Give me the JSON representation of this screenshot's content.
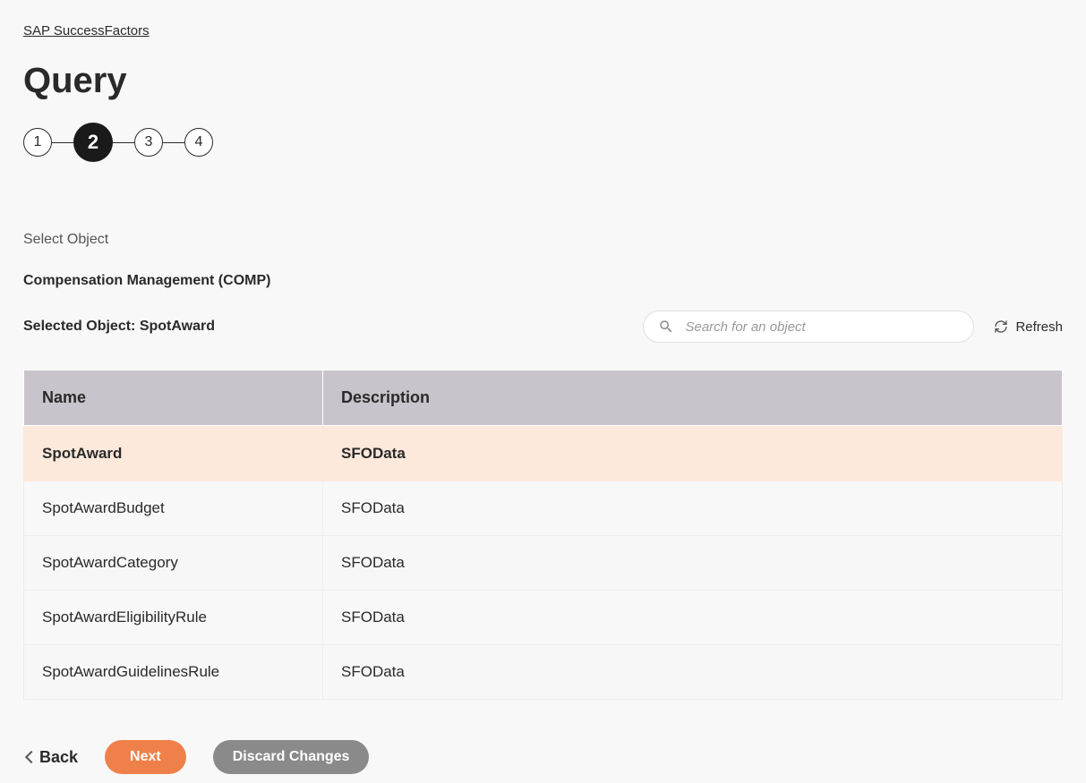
{
  "breadcrumb": "SAP SuccessFactors",
  "page_title": "Query",
  "stepper": {
    "steps": [
      "1",
      "2",
      "3",
      "4"
    ],
    "active_index": 1
  },
  "section_label": "Select Object",
  "category_label": "Compensation Management (COMP)",
  "selected_object_label": "Selected Object: SpotAward",
  "search": {
    "placeholder": "Search for an object"
  },
  "refresh_label": "Refresh",
  "table": {
    "headers": {
      "name": "Name",
      "description": "Description"
    },
    "rows": [
      {
        "name": "SpotAward",
        "description": "SFOData",
        "selected": true
      },
      {
        "name": "SpotAwardBudget",
        "description": "SFOData",
        "selected": false
      },
      {
        "name": "SpotAwardCategory",
        "description": "SFOData",
        "selected": false
      },
      {
        "name": "SpotAwardEligibilityRule",
        "description": "SFOData",
        "selected": false
      },
      {
        "name": "SpotAwardGuidelinesRule",
        "description": "SFOData",
        "selected": false
      }
    ]
  },
  "buttons": {
    "back": "Back",
    "next": "Next",
    "discard": "Discard Changes"
  }
}
